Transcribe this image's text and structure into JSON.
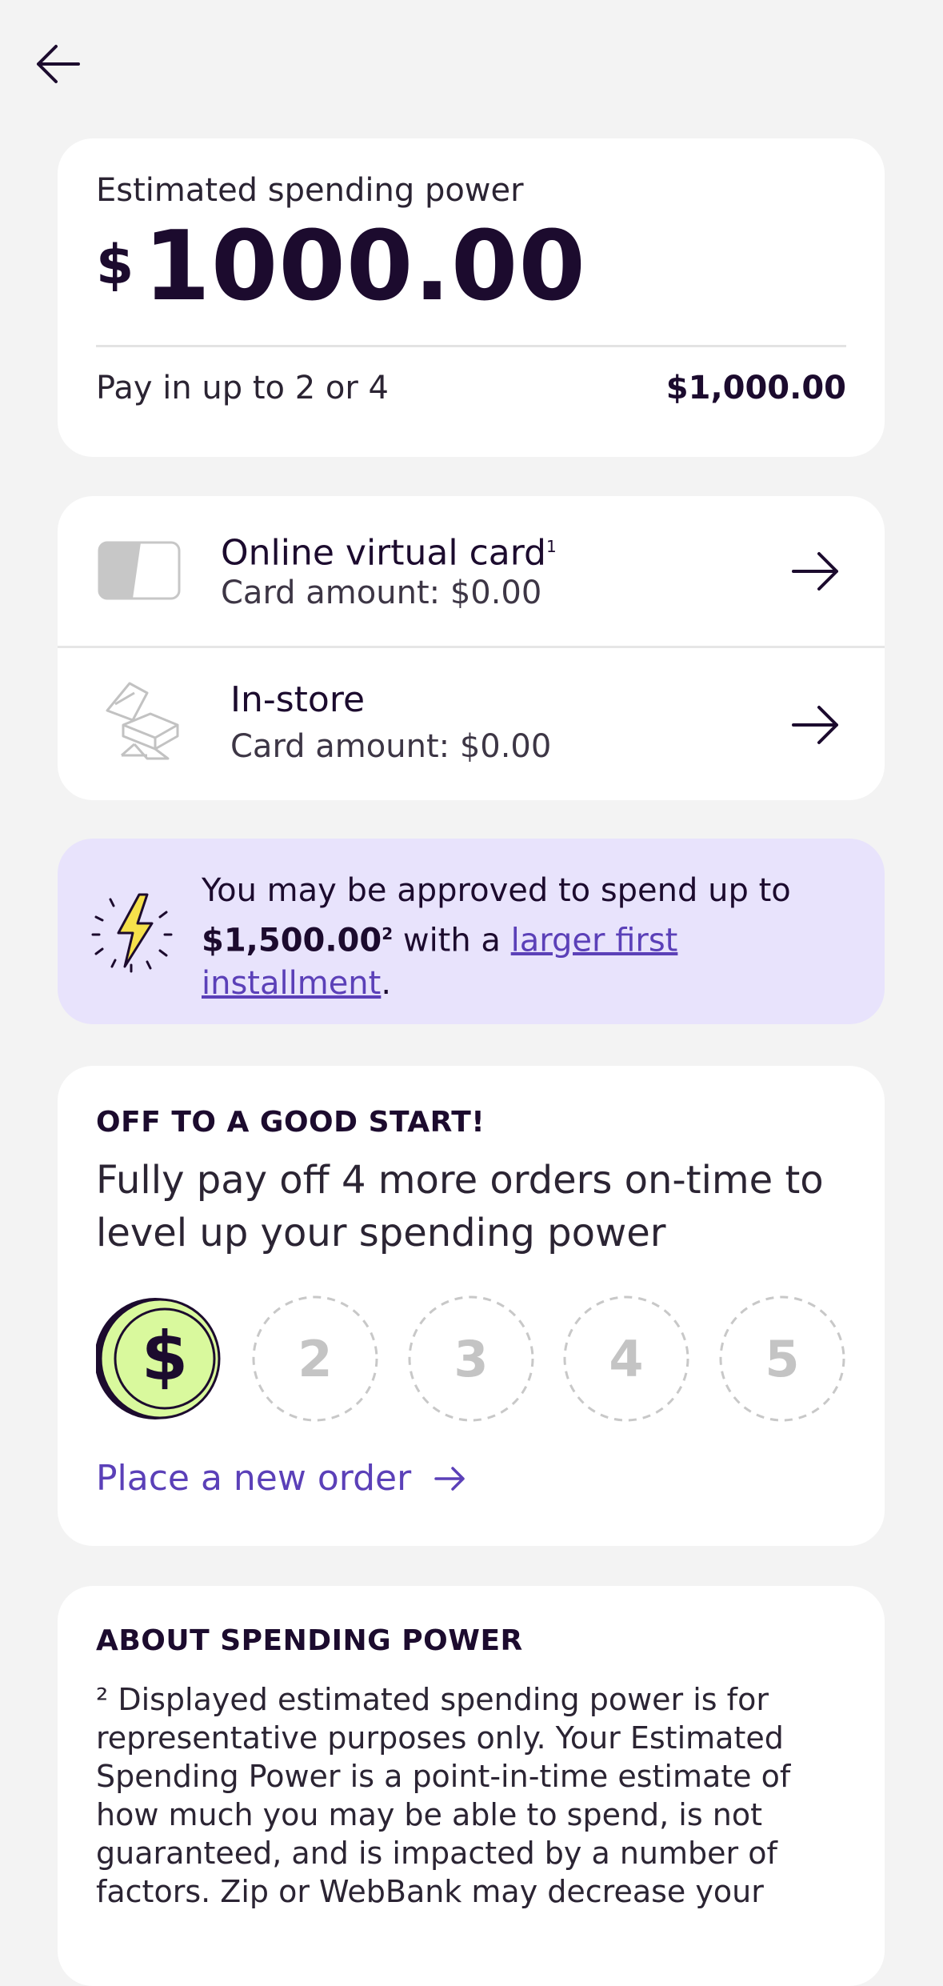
{
  "spending": {
    "label": "Estimated spending power",
    "currency_symbol": "$",
    "amount": "1000.00",
    "pay_label": "Pay in up to 2 or 4",
    "pay_amount": "$1,000.00"
  },
  "cards": [
    {
      "title": "Online virtual card",
      "footnote": "1",
      "subtitle": "Card amount: $0.00",
      "icon": "virtual-card-icon"
    },
    {
      "title": "In-store",
      "subtitle": "Card amount: $0.00",
      "icon": "in-store-icon"
    }
  ],
  "promo": {
    "icon": "lightning-icon",
    "text_before": "You may be approved to spend up to ",
    "amount": "$1,500.00",
    "footnote": "2",
    "text_middle": " with a ",
    "link": "larger first installment",
    "text_end": "."
  },
  "progress": {
    "eyebrow": "OFF TO A GOOD START!",
    "text": "Fully pay off 4 more orders on-time to level up your spending power",
    "steps": [
      "$",
      "2",
      "3",
      "4",
      "5"
    ],
    "completed_steps": 1,
    "cta": "Place a new order"
  },
  "about": {
    "title": "ABOUT SPENDING POWER",
    "body": "² Displayed estimated spending power is for representative purposes only. Your Estimated Spending Power is a point-in-time estimate of how much you may be able to spend, is not guaranteed, and is impacted by a number of factors. Zip or WebBank may decrease your"
  },
  "colors": {
    "background": "#f3f3f3",
    "accent_purple": "#5b40b8",
    "promo_bg": "#e8e3fc",
    "coin_green": "#d9f99d",
    "ink": "#1c0b2e"
  }
}
